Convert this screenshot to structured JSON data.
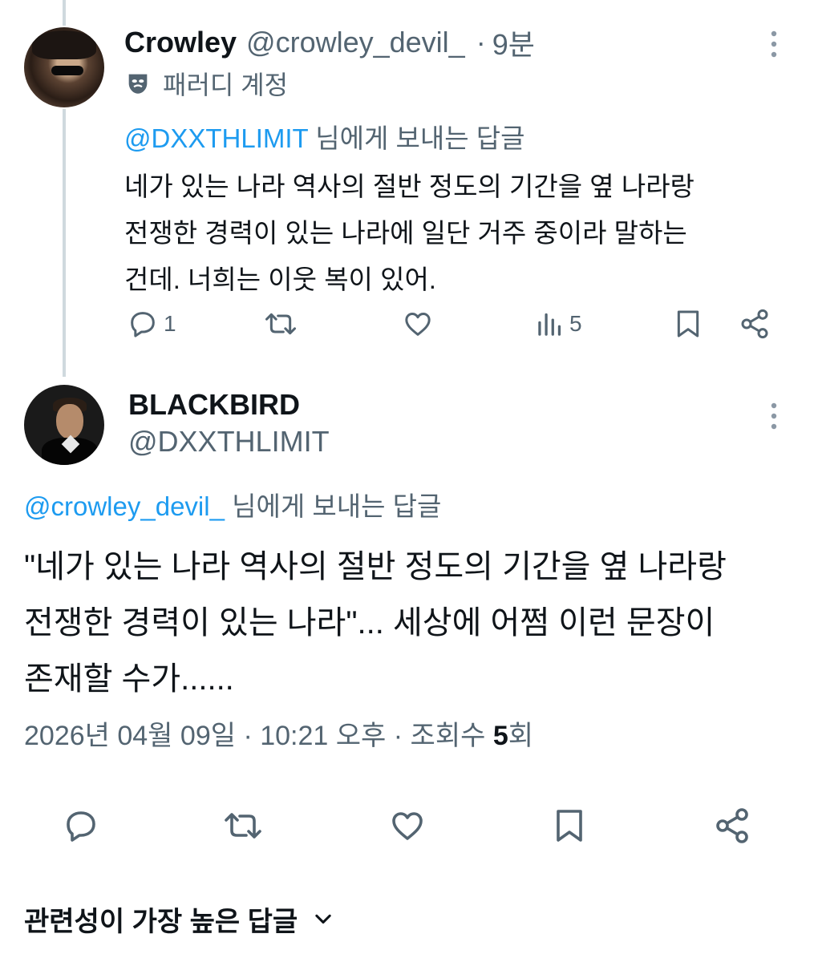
{
  "reply_tweet": {
    "display_name": "Crowley",
    "handle": "@crowley_devil_",
    "separator": "·",
    "time": "9분",
    "parody_label": "패러디 계정",
    "reply_to_handle": "@DXXTHLIMIT",
    "reply_to_suffix": " 님에게 보내는 답글",
    "text_lines": [
      "네가 있는 나라 역사의 절반 정도의 기간을 옆 나라랑",
      "전쟁한 경력이 있는 나라에 일단 거주 중이라 말하는",
      "건데. 너희는 이웃 복이 있어."
    ],
    "reply_count": "1",
    "views_count": "5"
  },
  "main_tweet": {
    "display_name": "BLACKBIRD",
    "handle": "@DXXTHLIMIT",
    "reply_to_handle": "@crowley_devil_",
    "reply_to_suffix": " 님에게 보내는 답글",
    "text_lines": [
      "\"네가 있는 나라 역사의 절반 정도의 기간을 옆 나라랑",
      "전쟁한 경력이 있는 나라\"... 세상에 어쩜 이런 문장이",
      "존재할 수가......"
    ],
    "date": "2026년 04월 09일",
    "time": "10:21 오후",
    "views_label": "조회수",
    "views_count": "5",
    "views_unit": "회",
    "meta_separator": " · "
  },
  "sort": {
    "label": "관련성이 가장 높은 답글"
  },
  "icons": {
    "reply": "reply-icon",
    "retweet": "retweet-icon",
    "like": "like-icon",
    "views": "views-icon",
    "bookmark": "bookmark-icon",
    "share": "share-icon",
    "more": "more-icon",
    "parody": "parody-mask-icon",
    "chevron": "chevron-down-icon"
  },
  "colors": {
    "link": "#1d9bf0",
    "secondary_text": "#536471",
    "primary_text": "#0f1419",
    "thread_line": "#cfd9de"
  }
}
